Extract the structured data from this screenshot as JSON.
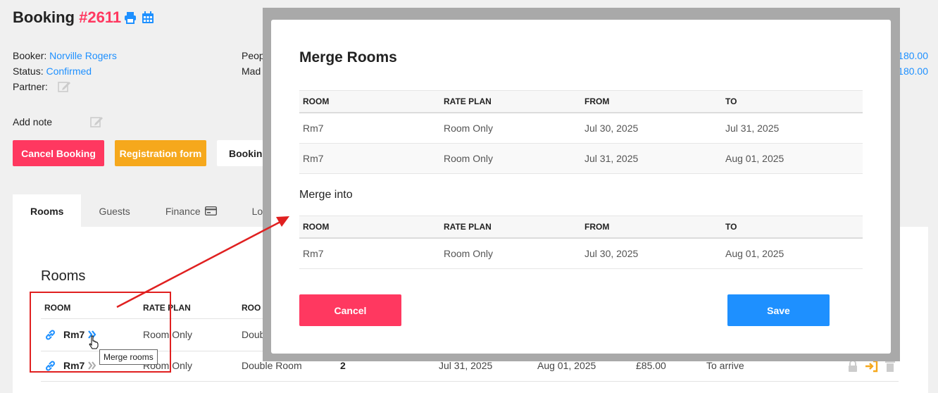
{
  "header": {
    "title": "Booking",
    "number": "#2611",
    "print_icon": "print-icon",
    "calendar_icon": "calendar-icon"
  },
  "info": {
    "booker_label": "Booker:",
    "booker_value": "Norville Rogers",
    "status_label": "Status:",
    "status_value": "Confirmed",
    "partner_label": "Partner:",
    "people_label": "Peop",
    "made_label": "Mad",
    "amount1": "180.00",
    "amount2": "180.00"
  },
  "note": {
    "label": "Add note"
  },
  "buttons": {
    "cancel_booking": "Cancel Booking",
    "registration_form": "Registration form",
    "booking": "Booking"
  },
  "tabs": [
    {
      "label": "Rooms"
    },
    {
      "label": "Guests"
    },
    {
      "label": "Finance",
      "icon": "credit-card-icon"
    },
    {
      "label": "Log"
    }
  ],
  "rooms_section": {
    "title": "Rooms",
    "columns": [
      "ROOM",
      "RATE PLAN",
      "ROO"
    ],
    "rows": [
      {
        "room": "Rm7",
        "rate_plan": "Room Only",
        "room_type": "Doub"
      },
      {
        "room": "Rm7",
        "rate_plan": "Room Only",
        "room_type": "Double Room",
        "guests": "2",
        "from": "Jul 31, 2025",
        "to": "Aug 01, 2025",
        "price": "£85.00",
        "status": "To arrive"
      }
    ],
    "tooltip": "Merge rooms"
  },
  "modal": {
    "title": "Merge Rooms",
    "columns": [
      "ROOM",
      "RATE PLAN",
      "FROM",
      "TO"
    ],
    "rows": [
      {
        "room": "Rm7",
        "rate_plan": "Room Only",
        "from": "Jul 30, 2025",
        "to": "Jul 31, 2025"
      },
      {
        "room": "Rm7",
        "rate_plan": "Room Only",
        "from": "Jul 31, 2025",
        "to": "Aug 01, 2025"
      }
    ],
    "merge_into_label": "Merge into",
    "merge_columns": [
      "ROOM",
      "RATE PLAN",
      "FROM",
      "TO"
    ],
    "merge_row": {
      "room": "Rm7",
      "rate_plan": "Room Only",
      "from": "Jul 30, 2025",
      "to": "Aug 01, 2025"
    },
    "cancel_label": "Cancel",
    "save_label": "Save"
  },
  "colors": {
    "accent": "#1e90ff",
    "danger": "#ff3860",
    "warning": "#f6a81c",
    "annotation": "#e02020"
  }
}
